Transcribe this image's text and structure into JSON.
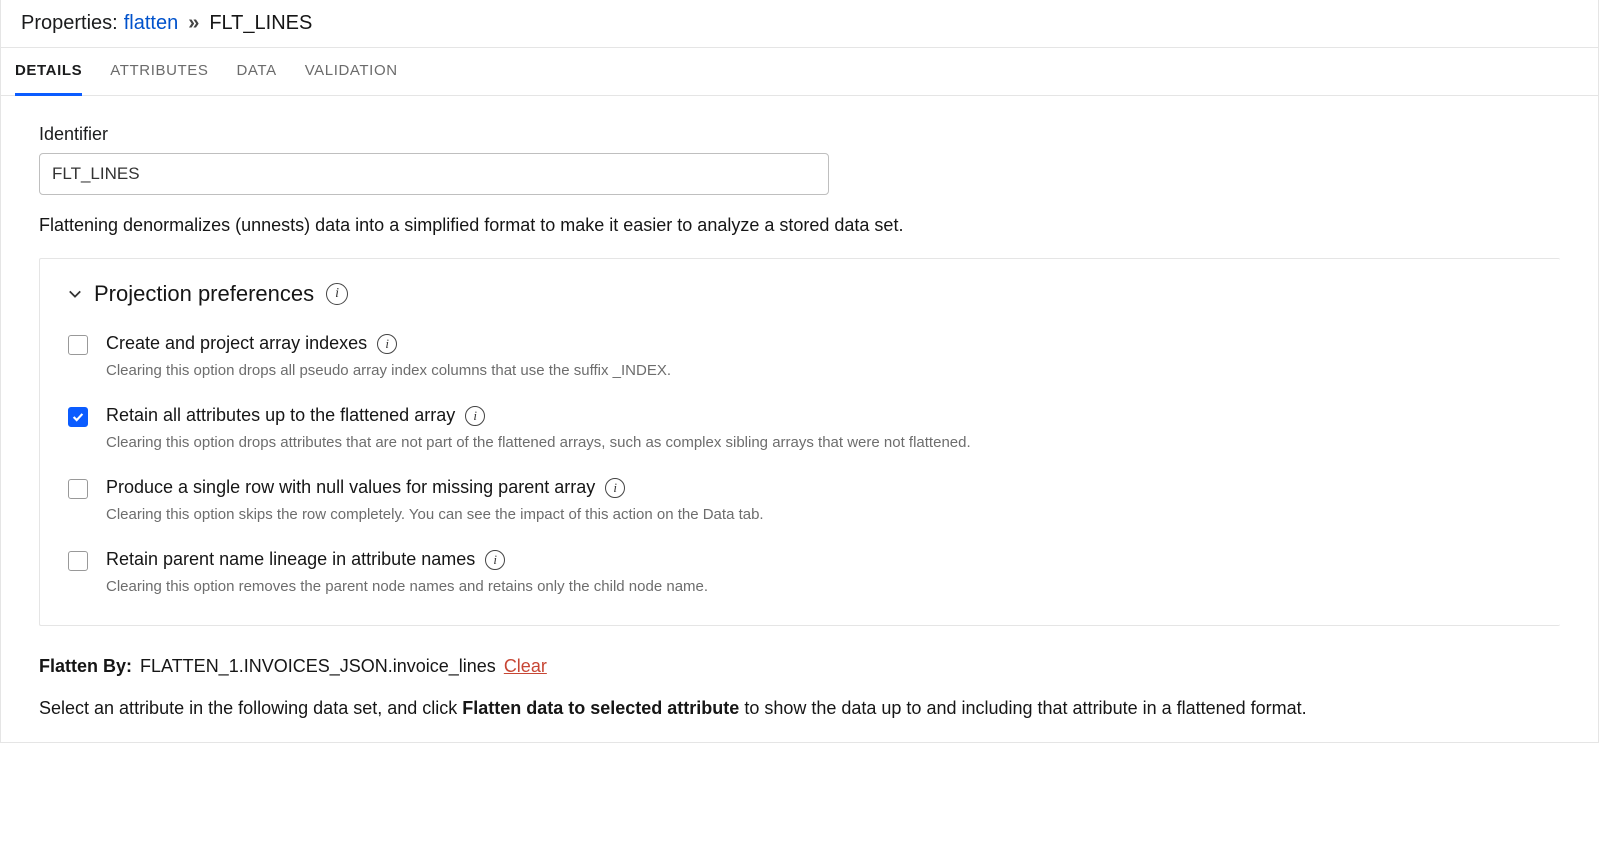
{
  "breadcrumb": {
    "prefix": "Properties:",
    "link": "flatten",
    "separator": "»",
    "current": "FLT_LINES"
  },
  "tabs": [
    {
      "label": "DETAILS",
      "active": true
    },
    {
      "label": "ATTRIBUTES",
      "active": false
    },
    {
      "label": "DATA",
      "active": false
    },
    {
      "label": "VALIDATION",
      "active": false
    }
  ],
  "identifier": {
    "label": "Identifier",
    "value": "FLT_LINES"
  },
  "description": "Flattening denormalizes (unnests) data into a simplified format to make it easier to analyze a stored data set.",
  "preferences": {
    "title": "Projection preferences",
    "options": [
      {
        "label": "Create and project array indexes",
        "desc": "Clearing this option drops all pseudo array index columns that use the suffix _INDEX.",
        "checked": false
      },
      {
        "label": "Retain all attributes up to the flattened array",
        "desc": "Clearing this option drops attributes that are not part of the flattened arrays, such as complex sibling arrays that were not flattened.",
        "checked": true
      },
      {
        "label": "Produce a single row with null values for missing parent array",
        "desc": "Clearing this option skips the row completely. You can see the impact of this action on the Data tab.",
        "checked": false
      },
      {
        "label": "Retain parent name lineage in attribute names",
        "desc": "Clearing this option removes the parent node names and retains only the child node name.",
        "checked": false
      }
    ]
  },
  "flattenBy": {
    "label": "Flatten By:",
    "path": "FLATTEN_1.INVOICES_JSON.invoice_lines",
    "clear": "Clear"
  },
  "instruction": {
    "pre": "Select an attribute in the following data set, and click ",
    "bold": "Flatten data to selected attribute",
    "post": " to show the data up to and including that attribute in a flattened format."
  }
}
